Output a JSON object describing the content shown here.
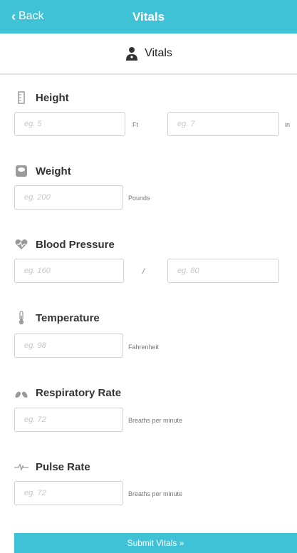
{
  "nav": {
    "back_label": "Back",
    "title": "Vitals"
  },
  "header": {
    "label": "Vitals",
    "icon": "doctor-icon"
  },
  "sections": {
    "height": {
      "title": "Height",
      "icon": "ruler-icon",
      "ft_placeholder": "eg. 5",
      "ft_unit": "Ft",
      "in_placeholder": "eg. 7",
      "in_unit": "in"
    },
    "weight": {
      "title": "Weight",
      "icon": "scale-icon",
      "placeholder": "eg. 200",
      "unit": "Pounds"
    },
    "blood_pressure": {
      "title": "Blood Pressure",
      "icon": "heart-icon",
      "systolic_placeholder": "eg. 160",
      "separator": "/",
      "diastolic_placeholder": "eg. 80"
    },
    "temperature": {
      "title": "Temperature",
      "icon": "thermometer-icon",
      "placeholder": "eg. 98",
      "unit": "Fahrenheit"
    },
    "respiratory_rate": {
      "title": "Respiratory Rate",
      "icon": "lungs-icon",
      "placeholder": "eg. 72",
      "unit": "Breaths per minute"
    },
    "pulse_rate": {
      "title": "Pulse Rate",
      "icon": "pulse-icon",
      "placeholder": "eg. 72",
      "unit": "Breaths per minute"
    }
  },
  "submit_label": "Submit Vitals »",
  "colors": {
    "accent": "#3fc1d6",
    "icon_gray": "#9a9a9a"
  }
}
